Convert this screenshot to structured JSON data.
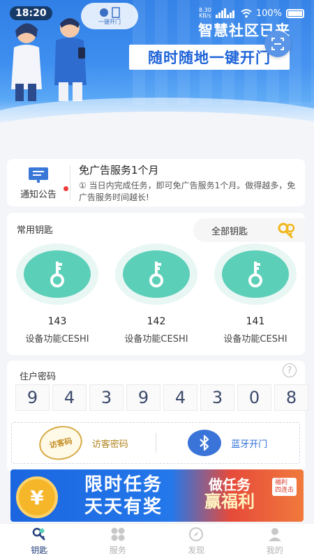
{
  "status_bar": {
    "time": "18:20",
    "net_speed_value": "8.30",
    "net_speed_unit": "KB/s",
    "battery": "100%"
  },
  "banner": {
    "bubble_label": "一键开门",
    "slogan_top": "智慧社区已来",
    "slogan_main": "随时随地一键开门"
  },
  "notice": {
    "label": "通知公告",
    "title": "免广告服务1个月",
    "description": "① 当日内完成任务，即可免广告服务1个月。做得越多，免广告服务时间越长!"
  },
  "keys": {
    "title": "常用钥匙",
    "all_keys_label": "全部钥匙",
    "items": [
      {
        "number": "143",
        "name": "设备功能CESHI"
      },
      {
        "number": "142",
        "name": "设备功能CESHI"
      },
      {
        "number": "141",
        "name": "设备功能CESHI"
      }
    ]
  },
  "password": {
    "title": "住户密码",
    "help": "?",
    "digits": [
      "9",
      "4",
      "3",
      "9",
      "4",
      "3",
      "0",
      "8"
    ],
    "visitor_stamp": "访客码",
    "visitor_label": "访客密码",
    "bluetooth_label": "蓝牙开门"
  },
  "promo": {
    "coin_symbol": "¥",
    "line1": "限时任务",
    "line2": "天天有奖",
    "tag_line1": "做任务",
    "tag_line2": "赢福利",
    "badge_line1": "福利",
    "badge_line2": "四连击"
  },
  "tabbar": {
    "items": [
      {
        "label": "钥匙",
        "icon": "key-icon"
      },
      {
        "label": "服务",
        "icon": "grid-icon"
      },
      {
        "label": "发现",
        "icon": "compass-icon"
      },
      {
        "label": "我的",
        "icon": "user-icon"
      }
    ]
  },
  "colors": {
    "brand_blue": "#2f7fe6",
    "key_teal": "#5ccfb8",
    "active_tab": "#1f3b7a"
  }
}
